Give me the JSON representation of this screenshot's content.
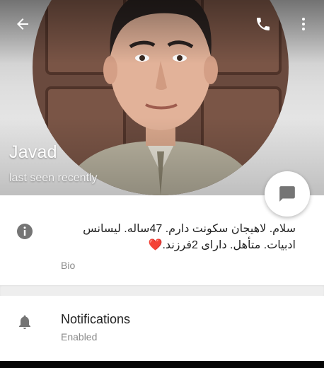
{
  "profile": {
    "name": "Javad",
    "status": "last seen recently"
  },
  "toolbar": {
    "back_icon": "arrow-left-icon",
    "call_icon": "phone-icon",
    "more_icon": "more-vertical-icon"
  },
  "fab": {
    "icon": "message-icon"
  },
  "bio": {
    "icon": "info-icon",
    "text": "سلام. لاهیجان سکونت دارم. 47ساله. لیسانس ادبیات. متأهل. دارای 2فرزند.❤️",
    "label": "Bio"
  },
  "notifications": {
    "icon": "bell-icon",
    "title": "Notifications",
    "value": "Enabled"
  },
  "colors": {
    "icon_gray": "#757575",
    "primary_text": "#222222",
    "secondary_text": "#8a8a8a",
    "divider": "#eeeeee"
  }
}
